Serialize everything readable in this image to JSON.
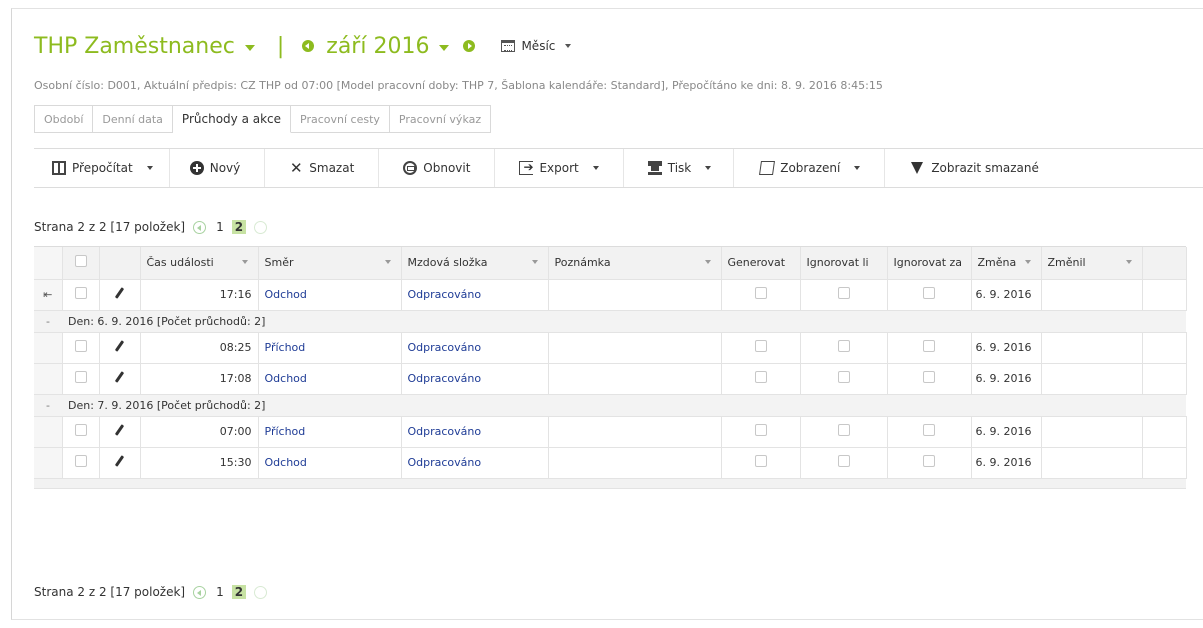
{
  "header": {
    "title": "THP Zaměstnanec",
    "separator": "|",
    "month": "září 2016",
    "view_mode": "Měsíc"
  },
  "info_line": "Osobní číslo: D001, Aktuální předpis: CZ THP od 07:00 [Model pracovní doby: THP 7, Šablona kalendáře: Standard], Přepočítáno ke dni: 8. 9. 2016 8:45:15",
  "tabs": [
    {
      "label": "Období"
    },
    {
      "label": "Denní data"
    },
    {
      "label": "Průchody a akce"
    },
    {
      "label": "Pracovní cesty"
    },
    {
      "label": "Pracovní výkaz"
    }
  ],
  "toolbar": {
    "recalc": "Přepočítat",
    "new": "Nový",
    "delete": "Smazat",
    "refresh": "Obnovit",
    "export": "Export",
    "print": "Tisk",
    "view": "Zobrazení",
    "show_deleted": "Zobrazit smazané"
  },
  "pager": {
    "text": "Strana 2 z 2 [17 položek]",
    "page1": "1",
    "page2": "2"
  },
  "columns": {
    "time": "Čas události",
    "direction": "Směr",
    "wage": "Mzdová složka",
    "note": "Poznámka",
    "generate": "Generovat",
    "ignore1": "Ignorovat li",
    "ignore2": "Ignorovat za",
    "changed": "Změna",
    "changed_by": "Změnil"
  },
  "rows": {
    "r0": {
      "time": "17:16",
      "direction": "Odchod",
      "wage": "Odpracováno",
      "changed": "6. 9. 2016"
    },
    "g1": "Den: 6. 9. 2016 [Počet průchodů: 2]",
    "r1": {
      "time": "08:25",
      "direction": "Příchod",
      "wage": "Odpracováno",
      "changed": "6. 9. 2016"
    },
    "r2": {
      "time": "17:08",
      "direction": "Odchod",
      "wage": "Odpracováno",
      "changed": "6. 9. 2016"
    },
    "g2": "Den: 7. 9. 2016 [Počet průchodů: 2]",
    "r3": {
      "time": "07:00",
      "direction": "Příchod",
      "wage": "Odpracováno",
      "changed": "6. 9. 2016"
    },
    "r4": {
      "time": "15:30",
      "direction": "Odchod",
      "wage": "Odpracováno",
      "changed": "6. 9. 2016"
    }
  },
  "colors": {
    "accent": "#8dbb1f",
    "link": "#1f3c96"
  }
}
